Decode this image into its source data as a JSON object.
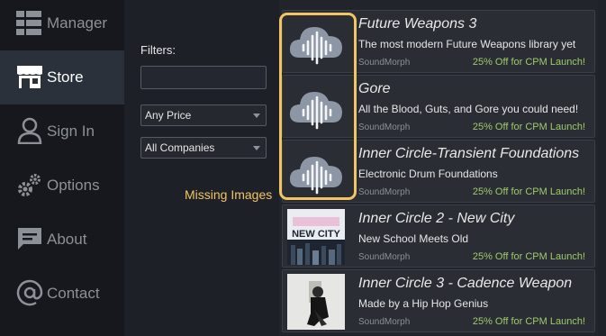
{
  "sidebar": {
    "items": [
      {
        "label": "Manager",
        "icon": "dashboard-icon"
      },
      {
        "label": "Store",
        "icon": "store-icon"
      },
      {
        "label": "Sign In",
        "icon": "person-icon"
      },
      {
        "label": "Options",
        "icon": "gears-icon"
      },
      {
        "label": "About",
        "icon": "chat-icon"
      },
      {
        "label": "Contact",
        "icon": "at-icon"
      }
    ],
    "active": "Store"
  },
  "filters": {
    "label": "Filters:",
    "search_value": "",
    "price_select": "Any Price",
    "company_select": "All Companies"
  },
  "annotation": {
    "missing_images": "Missing Images",
    "color": "#f3c463"
  },
  "products": [
    {
      "title": "Future Weapons 3",
      "description": "The most modern Future Weapons library yet",
      "vendor": "SoundMorph",
      "promo": "25% Off for CPM Launch!",
      "image": "placeholder-cloud-icon"
    },
    {
      "title": "Gore",
      "description": "All the Blood, Guts, and Gore you could need!",
      "vendor": "SoundMorph",
      "promo": "25% Off for CPM Launch!",
      "image": "placeholder-cloud-icon"
    },
    {
      "title": "Inner Circle-Transient Foundations",
      "description": "Electronic Drum Foundations",
      "vendor": "SoundMorph",
      "promo": "25% Off for CPM Launch!",
      "image": "placeholder-cloud-icon"
    },
    {
      "title": "Inner Circle 2 - New City",
      "description": "New School Meets Old",
      "vendor": "SoundMorph",
      "promo": "25% Off for CPM Launch!",
      "image": "new-city-cover",
      "cover_text": "NEW CITY"
    },
    {
      "title": "Inner Circle 3 - Cadence Weapon",
      "description": "Made by a Hip Hop Genius",
      "vendor": "SoundMorph",
      "promo": "25% Off for CPM Launch!",
      "image": "cadence-weapon-cover"
    }
  ],
  "colors": {
    "accent_highlight": "#f3c463",
    "promo_green": "#9fcb6b",
    "sidebar_bg": "#16181d",
    "active_bg": "#2a313a"
  }
}
